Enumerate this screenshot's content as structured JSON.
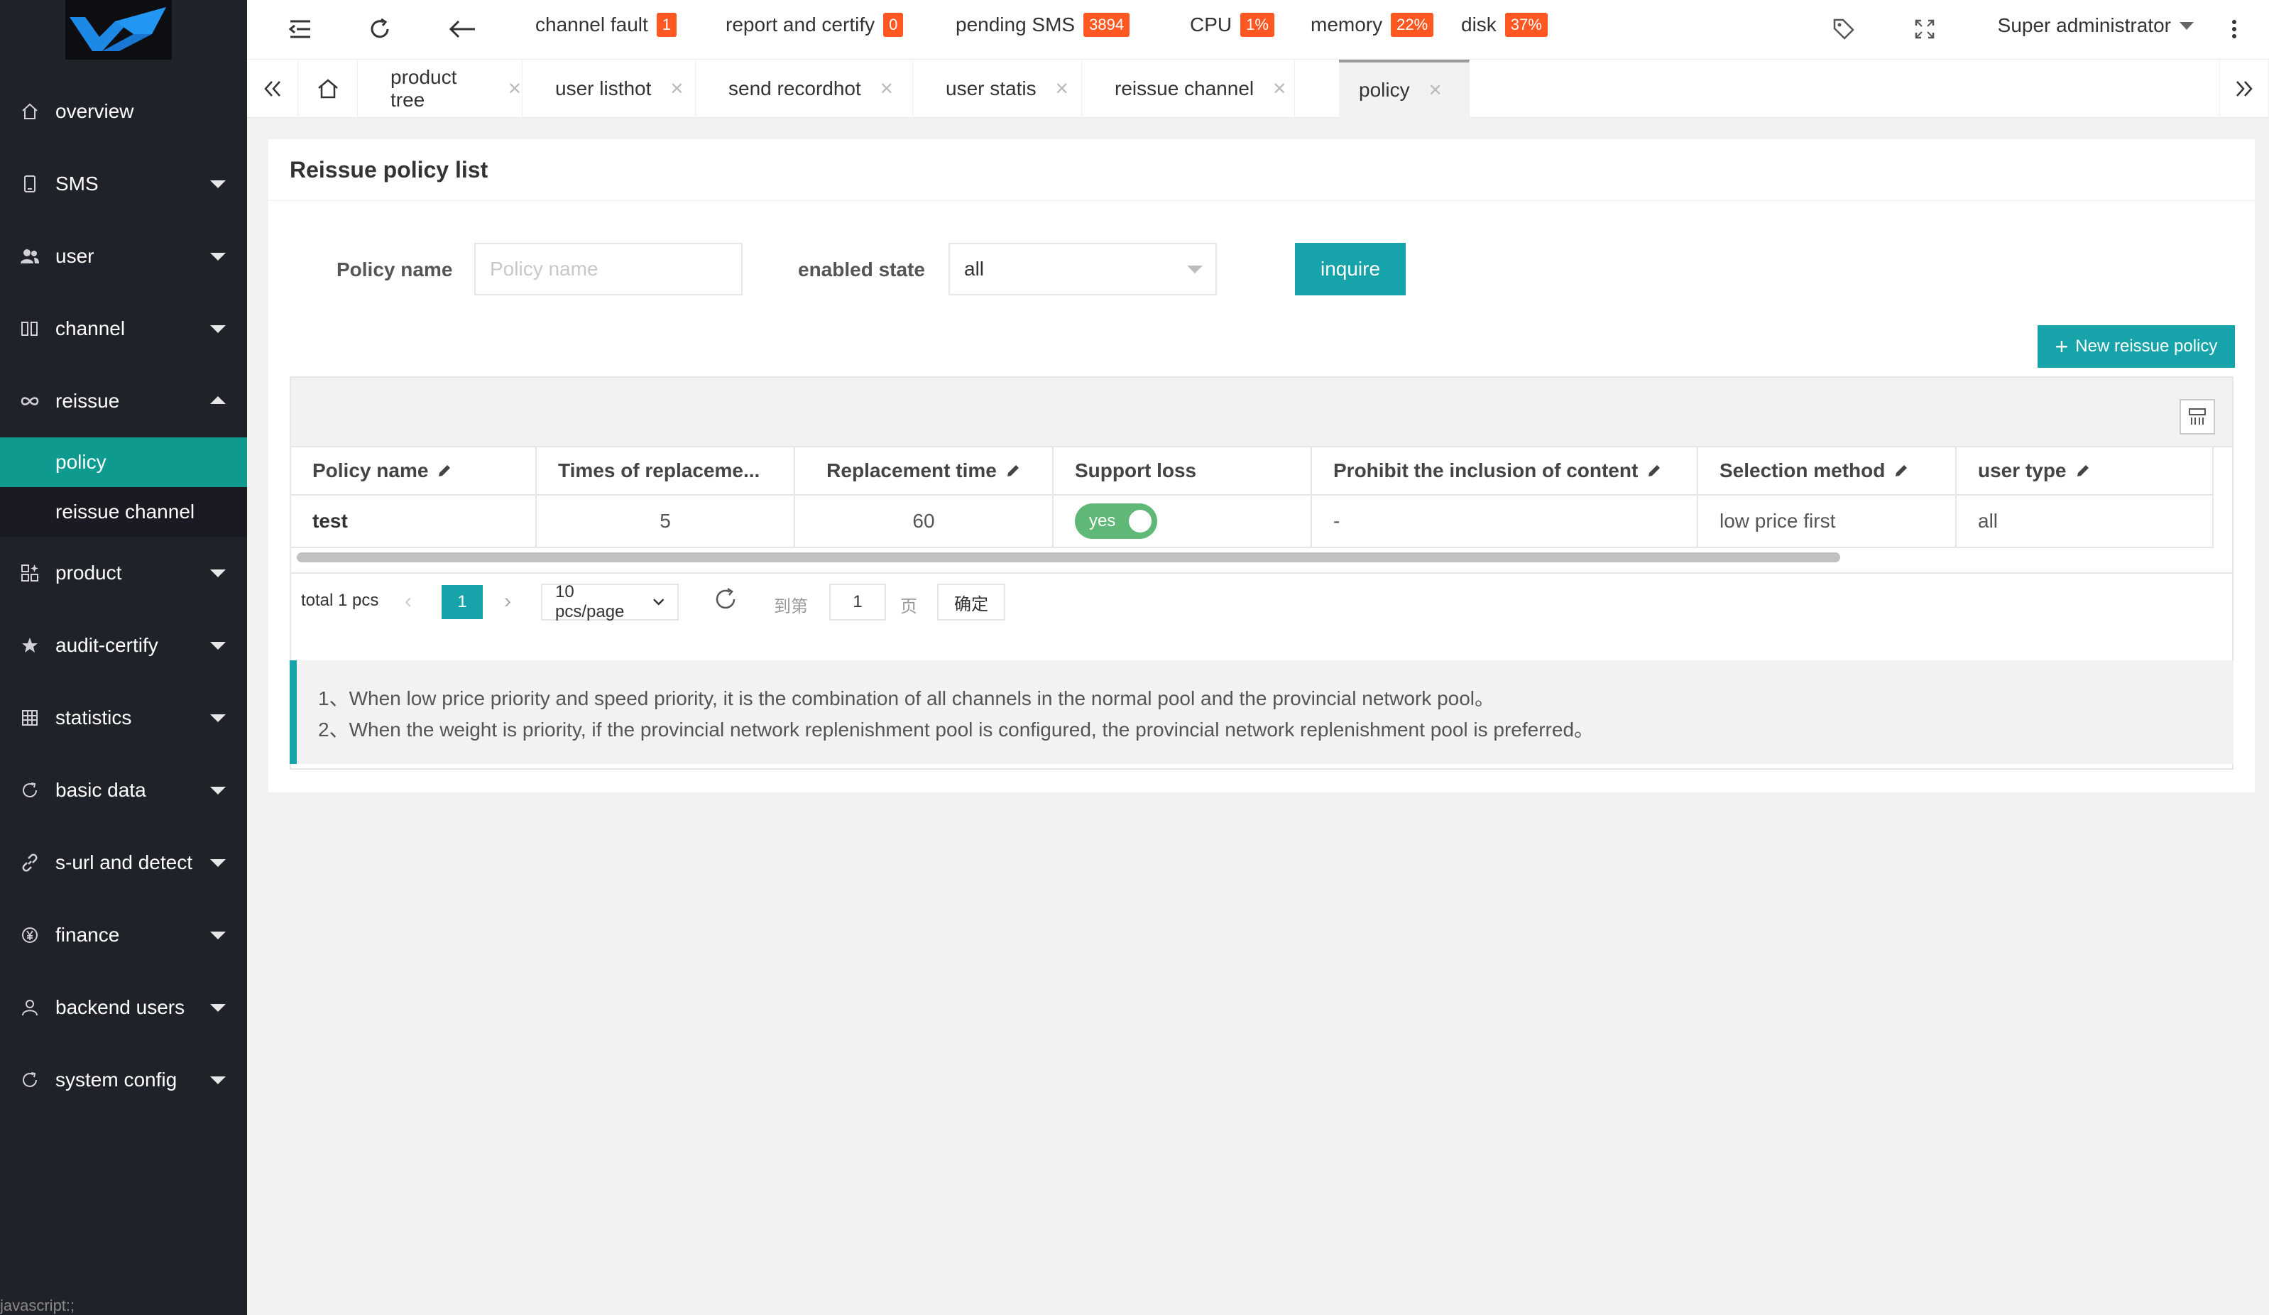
{
  "header": {
    "metrics": [
      {
        "label": "channel fault",
        "value": "1"
      },
      {
        "label": "report and certify",
        "value": "0"
      },
      {
        "label": "pending SMS",
        "value": "3894"
      },
      {
        "label": "CPU",
        "value": "1%"
      },
      {
        "label": "memory",
        "value": "22%"
      },
      {
        "label": "disk",
        "value": "37%"
      }
    ],
    "user": "Super administrator",
    "badge_color": "#ff5722"
  },
  "sidebar": {
    "items": [
      {
        "label": "overview",
        "icon": "home-icon"
      },
      {
        "label": "SMS",
        "icon": "phone-icon"
      },
      {
        "label": "user",
        "icon": "users-icon"
      },
      {
        "label": "channel",
        "icon": "channel-icon"
      },
      {
        "label": "reissue",
        "icon": "infinity-icon"
      },
      {
        "label": "product",
        "icon": "apps-icon"
      },
      {
        "label": "audit-certify",
        "icon": "star-icon"
      },
      {
        "label": "statistics",
        "icon": "grid-icon"
      },
      {
        "label": "basic data",
        "icon": "refresh-icon"
      },
      {
        "label": "s-url and detect",
        "icon": "link-icon"
      },
      {
        "label": "finance",
        "icon": "yen-icon"
      },
      {
        "label": "backend users",
        "icon": "person-icon"
      },
      {
        "label": "system config",
        "icon": "refresh-icon"
      }
    ],
    "reissue_sub": [
      "policy",
      "reissue channel"
    ],
    "active_color": "#0e9a8e",
    "status": "javascript:;"
  },
  "tabs": [
    "product tree",
    "user listhot",
    "send recordhot",
    "user statis",
    "reissue channel",
    "policy"
  ],
  "page": {
    "title": "Reissue policy list",
    "filters": {
      "policy_name_label": "Policy name",
      "policy_name_placeholder": "Policy name",
      "enabled_label": "enabled state",
      "enabled_value": "all",
      "inquire": "inquire"
    },
    "new_button": "New reissue policy",
    "accent": "#16a3a9"
  },
  "table": {
    "columns": [
      "Policy name",
      "Times of replaceme...",
      "Replacement time",
      "Support loss",
      "Prohibit the inclusion of content",
      "Selection method",
      "user type"
    ],
    "rows": [
      {
        "name": "test",
        "times": "5",
        "time": "60",
        "support_loss": "yes",
        "prohibit": "-",
        "method": "low price first",
        "user_type": "all"
      }
    ],
    "pager": {
      "total": "total 1 pcs",
      "current": "1",
      "per_page": "10 pcs/page",
      "goto_prefix": "到第",
      "goto_value": "1",
      "goto_suffix": "页",
      "confirm": "确定"
    }
  },
  "tips": [
    "1、When low price priority and speed priority, it is the combination of all channels in the normal pool and the provincial network pool。",
    "2、When the weight is priority, if the provincial network replenishment pool is configured, the provincial network replenishment pool is preferred。"
  ]
}
